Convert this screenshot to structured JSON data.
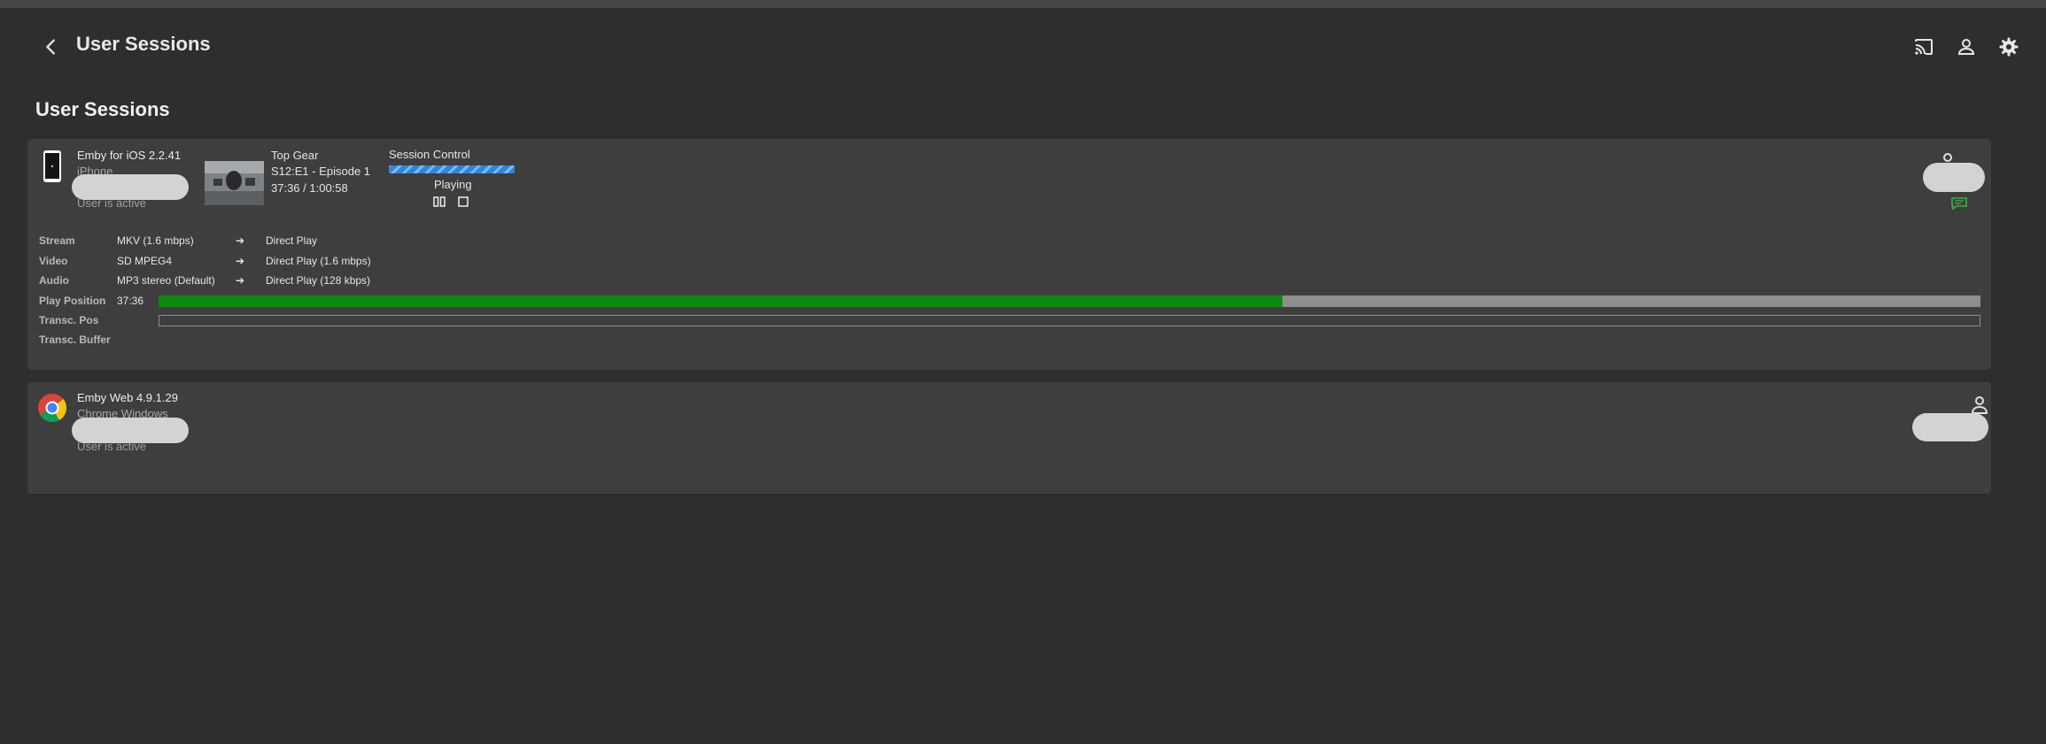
{
  "header": {
    "title": "User Sessions",
    "icons": [
      "back-arrow-icon",
      "cast-icon",
      "user-icon",
      "gear-icon"
    ]
  },
  "page": {
    "title": "User Sessions"
  },
  "sessions": [
    {
      "client": "Emby for iOS 2.2.41",
      "device": "iPhone",
      "status": "User is active",
      "device_icon": "phone-icon",
      "now_playing": {
        "title": "Top Gear",
        "episode": "S12:E1 - Episode 1",
        "time": "37:36 / 1:00:58"
      },
      "session_control": {
        "label": "Session Control",
        "status": "Playing"
      },
      "info": {
        "stream": {
          "label": "Stream",
          "value": "MKV (1.6 mbps)",
          "arrow": "➔",
          "dest": "Direct Play"
        },
        "video": {
          "label": "Video",
          "value": "SD MPEG4",
          "arrow": "➔",
          "dest": "Direct Play (1.6 mbps)"
        },
        "audio": {
          "label": "Audio",
          "value": "MP3 stereo (Default)",
          "arrow": "➔",
          "dest": "Direct Play (128 kbps)"
        },
        "play_position": {
          "label": "Play Position",
          "value": "37:36",
          "progress": 0.617
        },
        "transc_pos": {
          "label": "Transc. Pos"
        },
        "transc_buffer": {
          "label": "Transc. Buffer"
        }
      },
      "colors": {
        "progress": "#0e8a0e",
        "session_bar": "#2f86db",
        "message": "#3cb043"
      }
    },
    {
      "client": "Emby Web 4.9.1.29",
      "device": "Chrome Windows",
      "status": "User is active",
      "device_icon": "chrome-icon"
    }
  ]
}
